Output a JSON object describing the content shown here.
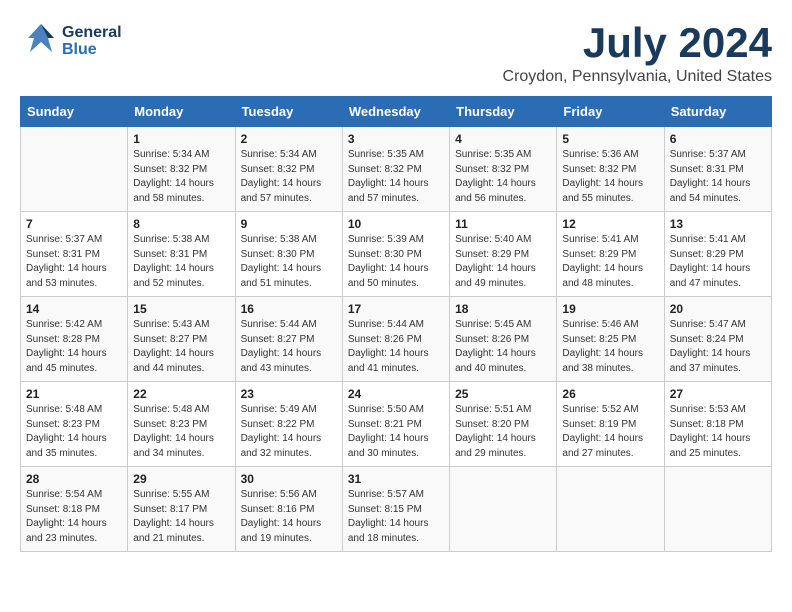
{
  "logo": {
    "general": "General",
    "blue": "Blue"
  },
  "title": "July 2024",
  "location": "Croydon, Pennsylvania, United States",
  "weekdays": [
    "Sunday",
    "Monday",
    "Tuesday",
    "Wednesday",
    "Thursday",
    "Friday",
    "Saturday"
  ],
  "weeks": [
    [
      {
        "day": "",
        "info": ""
      },
      {
        "day": "1",
        "info": "Sunrise: 5:34 AM\nSunset: 8:32 PM\nDaylight: 14 hours\nand 58 minutes."
      },
      {
        "day": "2",
        "info": "Sunrise: 5:34 AM\nSunset: 8:32 PM\nDaylight: 14 hours\nand 57 minutes."
      },
      {
        "day": "3",
        "info": "Sunrise: 5:35 AM\nSunset: 8:32 PM\nDaylight: 14 hours\nand 57 minutes."
      },
      {
        "day": "4",
        "info": "Sunrise: 5:35 AM\nSunset: 8:32 PM\nDaylight: 14 hours\nand 56 minutes."
      },
      {
        "day": "5",
        "info": "Sunrise: 5:36 AM\nSunset: 8:32 PM\nDaylight: 14 hours\nand 55 minutes."
      },
      {
        "day": "6",
        "info": "Sunrise: 5:37 AM\nSunset: 8:31 PM\nDaylight: 14 hours\nand 54 minutes."
      }
    ],
    [
      {
        "day": "7",
        "info": "Sunrise: 5:37 AM\nSunset: 8:31 PM\nDaylight: 14 hours\nand 53 minutes."
      },
      {
        "day": "8",
        "info": "Sunrise: 5:38 AM\nSunset: 8:31 PM\nDaylight: 14 hours\nand 52 minutes."
      },
      {
        "day": "9",
        "info": "Sunrise: 5:38 AM\nSunset: 8:30 PM\nDaylight: 14 hours\nand 51 minutes."
      },
      {
        "day": "10",
        "info": "Sunrise: 5:39 AM\nSunset: 8:30 PM\nDaylight: 14 hours\nand 50 minutes."
      },
      {
        "day": "11",
        "info": "Sunrise: 5:40 AM\nSunset: 8:29 PM\nDaylight: 14 hours\nand 49 minutes."
      },
      {
        "day": "12",
        "info": "Sunrise: 5:41 AM\nSunset: 8:29 PM\nDaylight: 14 hours\nand 48 minutes."
      },
      {
        "day": "13",
        "info": "Sunrise: 5:41 AM\nSunset: 8:29 PM\nDaylight: 14 hours\nand 47 minutes."
      }
    ],
    [
      {
        "day": "14",
        "info": "Sunrise: 5:42 AM\nSunset: 8:28 PM\nDaylight: 14 hours\nand 45 minutes."
      },
      {
        "day": "15",
        "info": "Sunrise: 5:43 AM\nSunset: 8:27 PM\nDaylight: 14 hours\nand 44 minutes."
      },
      {
        "day": "16",
        "info": "Sunrise: 5:44 AM\nSunset: 8:27 PM\nDaylight: 14 hours\nand 43 minutes."
      },
      {
        "day": "17",
        "info": "Sunrise: 5:44 AM\nSunset: 8:26 PM\nDaylight: 14 hours\nand 41 minutes."
      },
      {
        "day": "18",
        "info": "Sunrise: 5:45 AM\nSunset: 8:26 PM\nDaylight: 14 hours\nand 40 minutes."
      },
      {
        "day": "19",
        "info": "Sunrise: 5:46 AM\nSunset: 8:25 PM\nDaylight: 14 hours\nand 38 minutes."
      },
      {
        "day": "20",
        "info": "Sunrise: 5:47 AM\nSunset: 8:24 PM\nDaylight: 14 hours\nand 37 minutes."
      }
    ],
    [
      {
        "day": "21",
        "info": "Sunrise: 5:48 AM\nSunset: 8:23 PM\nDaylight: 14 hours\nand 35 minutes."
      },
      {
        "day": "22",
        "info": "Sunrise: 5:48 AM\nSunset: 8:23 PM\nDaylight: 14 hours\nand 34 minutes."
      },
      {
        "day": "23",
        "info": "Sunrise: 5:49 AM\nSunset: 8:22 PM\nDaylight: 14 hours\nand 32 minutes."
      },
      {
        "day": "24",
        "info": "Sunrise: 5:50 AM\nSunset: 8:21 PM\nDaylight: 14 hours\nand 30 minutes."
      },
      {
        "day": "25",
        "info": "Sunrise: 5:51 AM\nSunset: 8:20 PM\nDaylight: 14 hours\nand 29 minutes."
      },
      {
        "day": "26",
        "info": "Sunrise: 5:52 AM\nSunset: 8:19 PM\nDaylight: 14 hours\nand 27 minutes."
      },
      {
        "day": "27",
        "info": "Sunrise: 5:53 AM\nSunset: 8:18 PM\nDaylight: 14 hours\nand 25 minutes."
      }
    ],
    [
      {
        "day": "28",
        "info": "Sunrise: 5:54 AM\nSunset: 8:18 PM\nDaylight: 14 hours\nand 23 minutes."
      },
      {
        "day": "29",
        "info": "Sunrise: 5:55 AM\nSunset: 8:17 PM\nDaylight: 14 hours\nand 21 minutes."
      },
      {
        "day": "30",
        "info": "Sunrise: 5:56 AM\nSunset: 8:16 PM\nDaylight: 14 hours\nand 19 minutes."
      },
      {
        "day": "31",
        "info": "Sunrise: 5:57 AM\nSunset: 8:15 PM\nDaylight: 14 hours\nand 18 minutes."
      },
      {
        "day": "",
        "info": ""
      },
      {
        "day": "",
        "info": ""
      },
      {
        "day": "",
        "info": ""
      }
    ]
  ]
}
